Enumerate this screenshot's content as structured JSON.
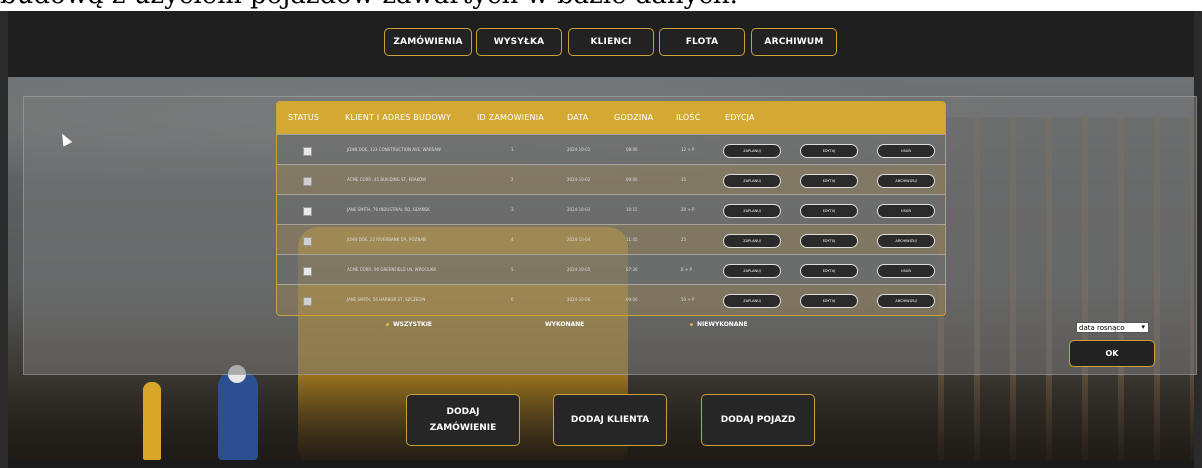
{
  "caption": {
    "text": "budową z użyciem pojazdów zawartych w bazie danych."
  },
  "nav": {
    "items": [
      "ZAMÓWIENIA",
      "WYSYŁKA",
      "KLIENCI",
      "FLOTA",
      "ARCHIWUM"
    ]
  },
  "table": {
    "headers": [
      "STATUS",
      "KLIENT I ADRES BUDOWY",
      "ID ZAMÓWIENIA",
      "DATA",
      "GODZINA",
      "ILOŚĆ",
      "EDYCJA"
    ],
    "rows": [
      {
        "checked": false,
        "client": "JOHN DOE, 123 CONSTRUCTION AVE, WARSAW",
        "id": "1",
        "date": "2024-10-01",
        "time": "08:00",
        "qty": "12 + P",
        "b1": "ZAPLANUJ",
        "b2": "EDYTUJ",
        "b3": "USUŃ"
      },
      {
        "checked": true,
        "client": "ACME CORP., 45 BUILDING ST, KRAKÓW",
        "id": "2",
        "date": "2024-10-02",
        "time": "09:00",
        "qty": "15",
        "b1": "ZAPLANUJ",
        "b2": "EDYTUJ",
        "b3": "ARCHIWIZUJ"
      },
      {
        "checked": false,
        "client": "JANE SMITH, 78 INDUSTRIAL RD, GDAŃSK",
        "id": "3",
        "date": "2024-10-03",
        "time": "10:15",
        "qty": "20 + P",
        "b1": "ZAPLANUJ",
        "b2": "EDYTUJ",
        "b3": "USUŃ"
      },
      {
        "checked": true,
        "client": "JOHN DOE, 22 RIVERBANK DR, POZNAŃ",
        "id": "4",
        "date": "2024-10-04",
        "time": "11:45",
        "qty": "25",
        "b1": "ZAPLANUJ",
        "b2": "EDYTUJ",
        "b3": "ARCHIWIZUJ"
      },
      {
        "checked": false,
        "client": "ACME CORP., 90 GREENFIELD LN, WROCŁAW",
        "id": "5",
        "date": "2024-10-05",
        "time": "07:30",
        "qty": "8 + P",
        "b1": "ZAPLANUJ",
        "b2": "EDYTUJ",
        "b3": "USUŃ"
      },
      {
        "checked": true,
        "client": "JANE SMITH, 56 HARBOR ST, SZCZECIN",
        "id": "6",
        "date": "2024-10-06",
        "time": "09:00",
        "qty": "50 + P",
        "b1": "ZAPLANUJ",
        "b2": "EDYTUJ",
        "b3": "ARCHIWIZUJ"
      }
    ]
  },
  "filters": {
    "all": "WSZYSTKIE",
    "done": "WYKONANE",
    "not_done": "NIEWYKONANE"
  },
  "sort": {
    "selected": "data rosnąco"
  },
  "ok": {
    "label": "OK"
  },
  "actions": {
    "add_order_1": "DODAJ",
    "add_order_2": "ZAMÓWIENIE",
    "add_client": "DODAJ KLIENTA",
    "add_vehicle": "DODAJ POJAZD"
  }
}
